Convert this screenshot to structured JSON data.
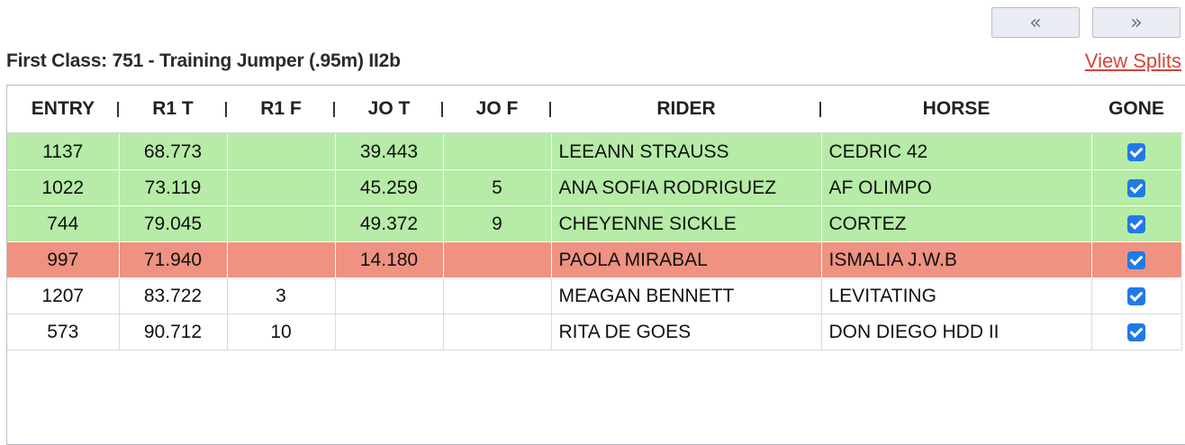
{
  "pager": {
    "prev": "«",
    "next": "»"
  },
  "class_title": "First Class: 751 - Training Jumper (.95m) II2b",
  "view_splits": "View Splits",
  "columns": [
    "ENTRY",
    "R1 T",
    "R1 F",
    "JO T",
    "JO F",
    "RIDER",
    "HORSE",
    "GONE"
  ],
  "row_colors": {
    "green": "#b6eca7",
    "red": "#ef9282",
    "checkbox": "#1f7ae8"
  },
  "rows": [
    {
      "status": "green",
      "entry": "1137",
      "r1t": "68.773",
      "r1f": "",
      "jot": "39.443",
      "jof": "",
      "rider": "LEEANN STRAUSS",
      "horse": "CEDRIC 42",
      "gone": true
    },
    {
      "status": "green",
      "entry": "1022",
      "r1t": "73.119",
      "r1f": "",
      "jot": "45.259",
      "jof": "5",
      "rider": "ANA SOFIA RODRIGUEZ",
      "horse": "AF OLIMPO",
      "gone": true
    },
    {
      "status": "green",
      "entry": "744",
      "r1t": "79.045",
      "r1f": "",
      "jot": "49.372",
      "jof": "9",
      "rider": "CHEYENNE SICKLE",
      "horse": "CORTEZ",
      "gone": true
    },
    {
      "status": "red",
      "entry": "997",
      "r1t": "71.940",
      "r1f": "",
      "jot": "14.180",
      "jof": "",
      "rider": "PAOLA MIRABAL",
      "horse": "ISMALIA J.W.B",
      "gone": true
    },
    {
      "status": "white",
      "entry": "1207",
      "r1t": "83.722",
      "r1f": "3",
      "jot": "",
      "jof": "",
      "rider": "MEAGAN BENNETT",
      "horse": "LEVITATING",
      "gone": true
    },
    {
      "status": "white",
      "entry": "573",
      "r1t": "90.712",
      "r1f": "10",
      "jot": "",
      "jof": "",
      "rider": "RITA DE GOES",
      "horse": "DON DIEGO HDD II",
      "gone": true
    }
  ]
}
